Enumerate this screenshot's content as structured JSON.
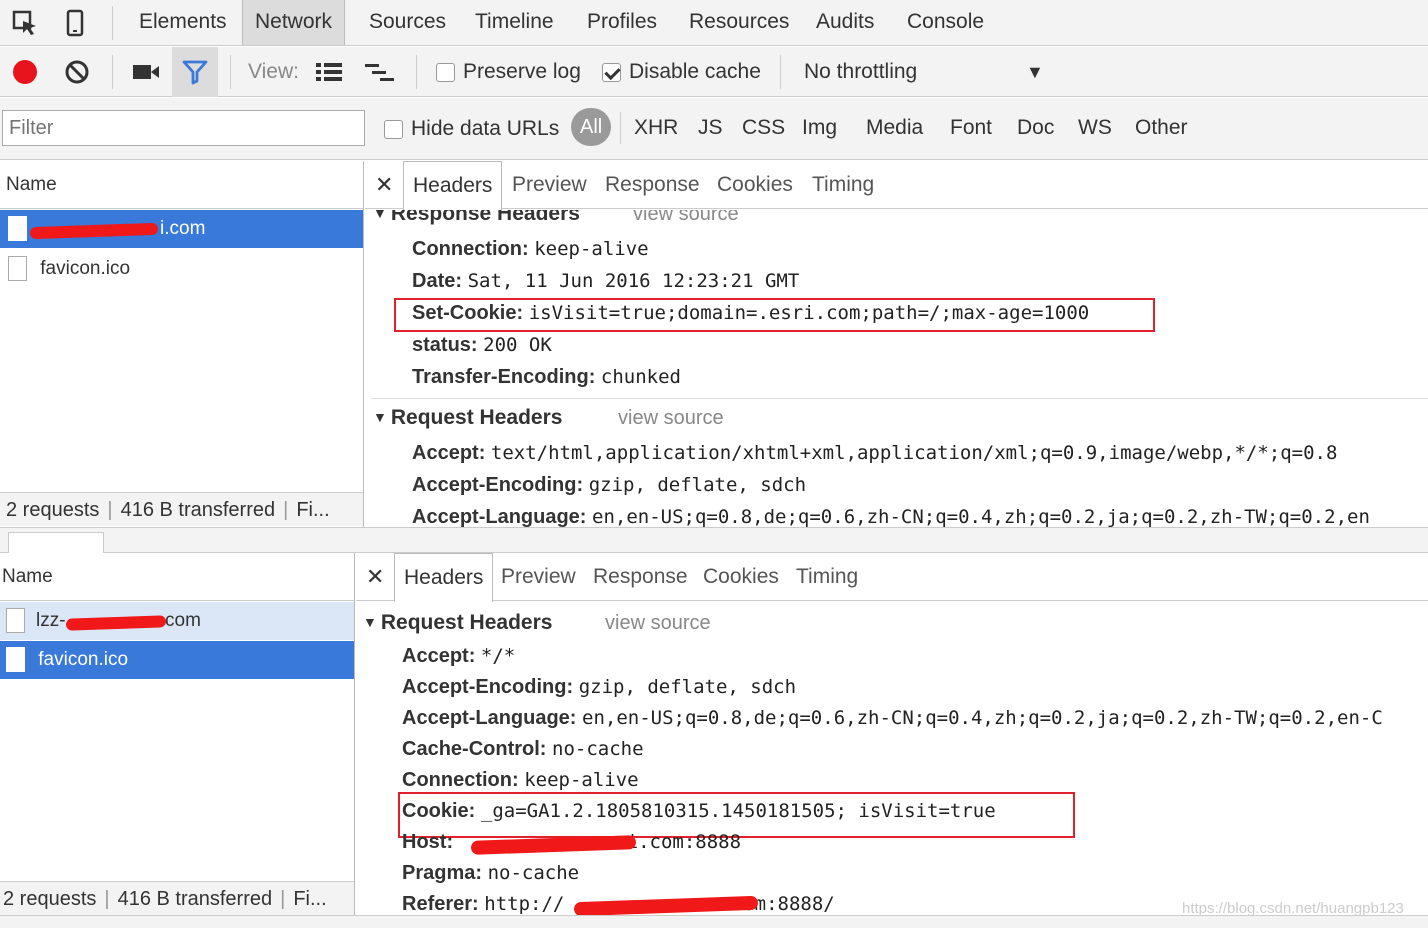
{
  "top_tabs": [
    "Elements",
    "Network",
    "Sources",
    "Timeline",
    "Profiles",
    "Resources",
    "Audits",
    "Console"
  ],
  "toolbar": {
    "view_label": "View:",
    "preserve_log": "Preserve log",
    "disable_cache": "Disable cache",
    "throttling": "No throttling",
    "preserve_checked": false,
    "disable_checked": true
  },
  "filter": {
    "placeholder": "Filter",
    "hide_data_urls": "Hide data URLs",
    "types": [
      "All",
      "XHR",
      "JS",
      "CSS",
      "Img",
      "Media",
      "Font",
      "Doc",
      "WS",
      "Other"
    ]
  },
  "detail_tabs": [
    "Headers",
    "Preview",
    "Response",
    "Cookies",
    "Timing"
  ],
  "panel1": {
    "col_name": "Name",
    "files": [
      {
        "name": "i.com",
        "selected": true
      },
      {
        "name": "favicon.ico",
        "selected": false
      }
    ],
    "status": {
      "requests": "2 requests",
      "transferred": "416 B transferred",
      "more": "Fi..."
    },
    "response_headers_title": "Response Headers",
    "view_source": "view source",
    "response_headers": [
      {
        "k": "Connection:",
        "v": "keep-alive"
      },
      {
        "k": "Date:",
        "v": "Sat, 11 Jun 2016 12:23:21 GMT"
      },
      {
        "k": "Set-Cookie:",
        "v": "isVisit=true;domain=.esri.com;path=/;max-age=1000"
      },
      {
        "k": "status:",
        "v": "200 OK"
      },
      {
        "k": "Transfer-Encoding:",
        "v": "chunked"
      }
    ],
    "request_headers_title": "Request Headers",
    "request_headers": [
      {
        "k": "Accept:",
        "v": "text/html,application/xhtml+xml,application/xml;q=0.9,image/webp,*/*;q=0.8"
      },
      {
        "k": "Accept-Encoding:",
        "v": "gzip, deflate, sdch"
      },
      {
        "k": "Accept-Language:",
        "v": "en,en-US;q=0.8,de;q=0.6,zh-CN;q=0.4,zh;q=0.2,ja;q=0.2,zh-TW;q=0.2,en"
      }
    ]
  },
  "panel2": {
    "col_name": "Name",
    "files": [
      {
        "prefix": "lzz-",
        "suffix": "com",
        "selected": false
      },
      {
        "name": "favicon.ico",
        "selected": true
      }
    ],
    "status": {
      "requests": "2 requests",
      "transferred": "416 B transferred",
      "more": "Fi..."
    },
    "request_headers_title": "Request Headers",
    "view_source": "view source",
    "request_headers": [
      {
        "k": "Accept:",
        "v": "*/*"
      },
      {
        "k": "Accept-Encoding:",
        "v": "gzip, deflate, sdch"
      },
      {
        "k": "Accept-Language:",
        "v": "en,en-US;q=0.8,de;q=0.6,zh-CN;q=0.4,zh;q=0.2,ja;q=0.2,zh-TW;q=0.2,en-C"
      },
      {
        "k": "Cache-Control:",
        "v": "no-cache"
      },
      {
        "k": "Connection:",
        "v": "keep-alive"
      },
      {
        "k": "Cookie:",
        "v": "_ga=GA1.2.1805810315.1450181505; isVisit=true"
      },
      {
        "k": "Host:",
        "v": "i.com:8888"
      },
      {
        "k": "Pragma:",
        "v": "no-cache"
      },
      {
        "k": "Referer:",
        "v": "http://"
      },
      {
        "k": "",
        "v": ".com:8888/"
      }
    ]
  },
  "watermark": "https://blog.csdn.net/huangpb123",
  "colors": {
    "selected_row": "#3879d9",
    "highlight_box": "#e0202a",
    "record": "#e8141c",
    "filter_active": "#3879d9"
  }
}
